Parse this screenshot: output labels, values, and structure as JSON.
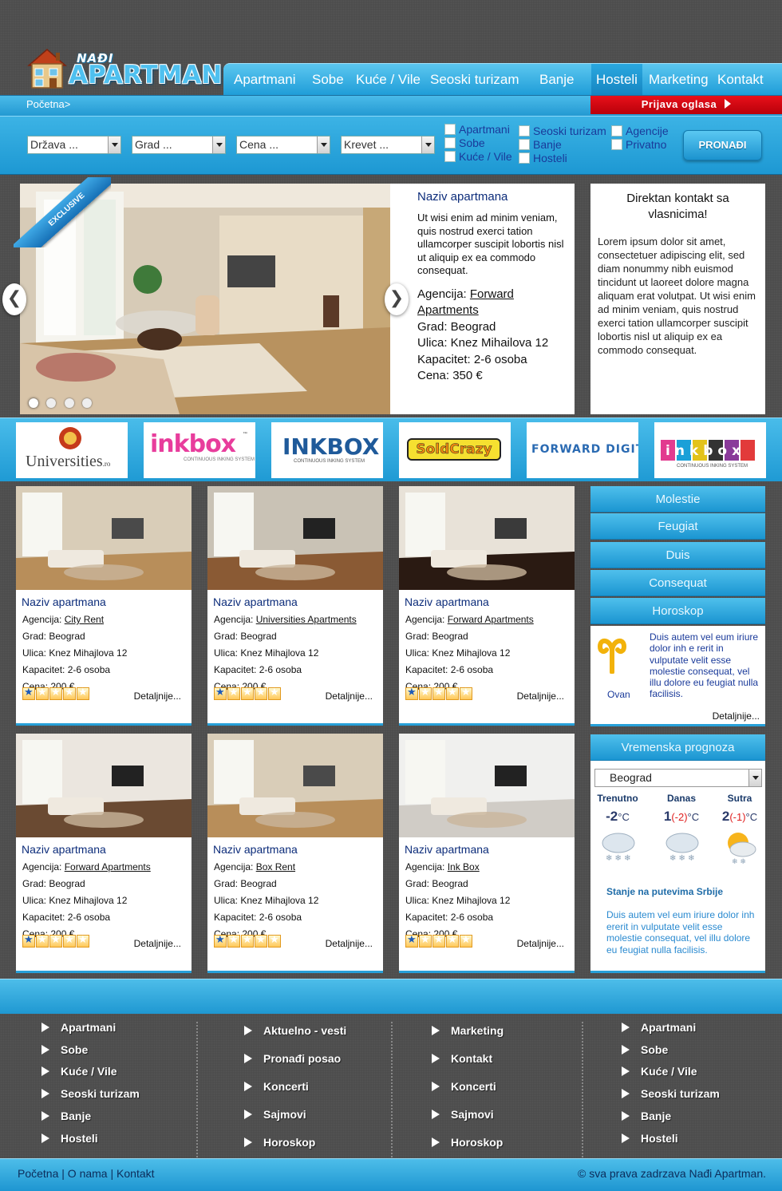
{
  "logo": {
    "small": "NAĐI",
    "main": "APARTMAN"
  },
  "nav": [
    "Apartmani",
    "Sobe",
    "Kuće / Vile",
    "Seoski turizam",
    "Banje",
    "Hosteli",
    "Marketing",
    "Kontakt"
  ],
  "nav_active": "Hosteli",
  "breadcrumb": "Početna>",
  "prijava": "Prijava oglasa",
  "search": {
    "selects": [
      "Država ...",
      "Grad ...",
      "Cena ...",
      "Krevet ..."
    ],
    "checks_col1": [
      "Apartmani",
      "Sobe",
      "Kuće / Vile"
    ],
    "checks_col2": [
      "Seoski turizam",
      "Banje",
      "Hosteli"
    ],
    "checks_col3": [
      "Agencije",
      "Privatno"
    ],
    "button": "PRONAĐI"
  },
  "slider": {
    "badge": "EXCLUSIVE",
    "prev": "❮",
    "next": "❯",
    "title": "Naziv apartmana",
    "description": "Ut wisi enim ad minim veniam, quis nostrud exerci tation ullamcorper suscipit lobortis nisl ut aliquip ex ea commodo consequat.",
    "agency_label": "Agencija: ",
    "agency": "Forward Apartments",
    "city": "Grad: Beograd",
    "street": "Ulica: Knez Mihailova 12",
    "capacity": "Kapacitet: 2-6 osoba",
    "price": "Cena: 350 €"
  },
  "contact": {
    "title": "Direktan kontakt sa vlasnicima!",
    "text": "Lorem ipsum dolor sit amet, consectetuer adipiscing elit, sed diam nonummy nibh euismod tincidunt ut laoreet dolore magna aliquam erat volutpat. Ut wisi enim ad minim veniam, quis nostrud exerci tation ullamcorper suscipit lobortis nisl ut aliquip ex ea commodo consequat."
  },
  "partners": [
    "Universities.ro",
    "inkbox",
    "INKBOX",
    "SoldCrazy",
    "FORWARD DIGITAL",
    "inkbox"
  ],
  "partner_sub": {
    "universities": "Universities",
    "universities_tld": ".ro",
    "inkbox_sub": "CONTINUOUS INKING SYSTEM",
    "tm": "™"
  },
  "card_labels": {
    "agency": "Agencija: ",
    "details": "Detaljnije..."
  },
  "cards": [
    {
      "title": "Naziv apartmana",
      "agency": "City Rent",
      "city": "Grad: Beograd",
      "street": "Ulica: Knez Mihajlova 12",
      "capacity": "Kapacitet: 2-6 osoba",
      "price": "Cena: 200 €",
      "rating": 1
    },
    {
      "title": "Naziv apartmana",
      "agency": "Universities Apartments",
      "city": "Grad: Beograd",
      "street": "Ulica: Knez Mihajlova 12",
      "capacity": "Kapacitet: 2-6 osoba",
      "price": "Cena: 200 €",
      "rating": 1
    },
    {
      "title": "Naziv apartmana",
      "agency": "Forward Apartments",
      "city": "Grad: Beograd",
      "street": "Ulica: Knez Mihajlova 12",
      "capacity": "Kapacitet: 2-6 osoba",
      "price": "Cena: 200 €",
      "rating": 1
    },
    {
      "title": "Naziv apartmana",
      "agency": "Forward Apartments",
      "city": "Grad: Beograd",
      "street": "Ulica: Knez Mihajlova 12",
      "capacity": "Kapacitet: 2-6 osoba",
      "price": "Cena: 200 €",
      "rating": 1
    },
    {
      "title": "Naziv apartmana",
      "agency": "Box Rent",
      "city": "Grad: Beograd",
      "street": "Ulica: Knez Mihajlova 12",
      "capacity": "Kapacitet: 2-6 osoba",
      "price": "Cena: 200 €",
      "rating": 1
    },
    {
      "title": "Naziv apartmana",
      "agency": "Ink Box",
      "city": "Grad: Beograd",
      "street": "Ulica: Knez Mihajlova 12",
      "capacity": "Kapacitet: 2-6 osoba",
      "price": "Cena: 200 €",
      "rating": 1
    }
  ],
  "side_tabs": [
    "Molestie",
    "Feugiat",
    "Duis",
    "Consequat",
    "Horoskop"
  ],
  "horoscope": {
    "sign": "Ovan",
    "text": "Duis autem vel eum iriure dolor inh e rerit in vulputate velit esse molestie consequat, vel illu dolore eu feugiat nulla facilisis.",
    "more": "Detaljnije..."
  },
  "weather": {
    "title": "Vremenska prognoza",
    "city": "Beograd",
    "days": [
      {
        "label": "Trenutno",
        "temp": "-2",
        "unit": "°C",
        "range": "",
        "icon": "snow-cloud-icon"
      },
      {
        "label": "Danas",
        "temp": "1",
        "unit": "°C",
        "range": "(-2)",
        "icon": "snow-cloud-icon"
      },
      {
        "label": "Sutra",
        "temp": "2",
        "unit": "°C",
        "range": "(-1)",
        "icon": "sun-snow-cloud-icon"
      }
    ],
    "road_title": "Stanje na putevima Srbije",
    "road_text": "Duis autem vel eum iriure dolor inh ererit in vulputate velit esse molestie consequat, vel illu dolore eu feugiat nulla facilisis."
  },
  "footer_cols": [
    [
      "Apartmani",
      "Sobe",
      "Kuće / Vile",
      "Seoski turizam",
      "Banje",
      "Hosteli"
    ],
    [
      "Aktuelno - vesti",
      "Pronađi posao",
      "Koncerti",
      "Sajmovi",
      "Horoskop"
    ],
    [
      "Marketing",
      "Kontakt",
      "Koncerti",
      "Sajmovi",
      "Horoskop"
    ],
    [
      "Apartmani",
      "Sobe",
      "Kuće / Vile",
      "Seoski turizam",
      "Banje",
      "Hosteli"
    ]
  ],
  "bottom_links": {
    "home": "Početna",
    "sep": " | ",
    "about": "O nama",
    "contact": "Kontakt"
  },
  "copyright": "© sva prava zadrzava Nađi Apartman."
}
